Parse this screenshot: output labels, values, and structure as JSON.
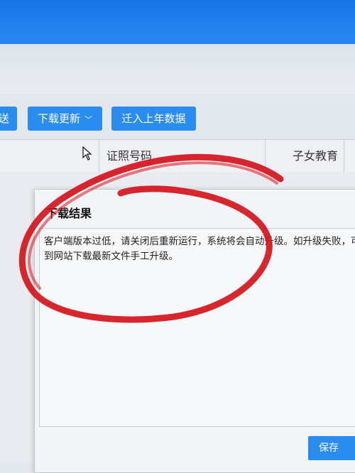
{
  "toolbar": {
    "send_label": "送",
    "download_update_label": "下载更新",
    "migrate_label": "迁入上年数据",
    "chevron": "﹀"
  },
  "table": {
    "headers": [
      "",
      "证照号码",
      "子女教育"
    ]
  },
  "dialog": {
    "title": "下载结果",
    "message": "客户端版本过低，请关闭后重新运行，系统将会自动升级。如升级失败，可到网站下载最新文件手工升级。",
    "save_label": "保存"
  },
  "colors": {
    "accent": "#2b8cf0",
    "annotation_red": "#d4141c"
  },
  "icons": [
    "chevron-down-icon",
    "mouse-cursor-icon"
  ]
}
